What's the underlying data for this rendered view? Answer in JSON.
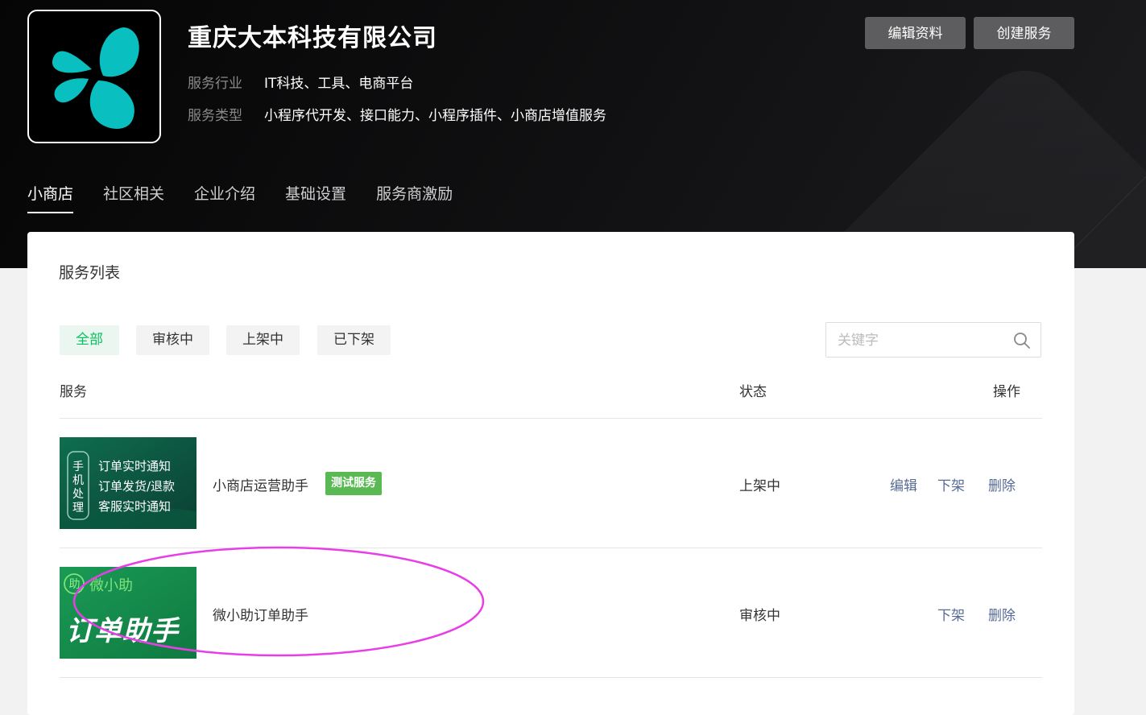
{
  "header": {
    "company_name": "重庆大本科技有限公司",
    "industry_label": "服务行业",
    "industry_value": "IT科技、工具、电商平台",
    "type_label": "服务类型",
    "type_value": "小程序代开发、接口能力、小程序插件、小商店增值服务",
    "edit_profile_label": "编辑资料",
    "create_service_label": "创建服务"
  },
  "tabs": [
    {
      "label": "小商店",
      "active": true
    },
    {
      "label": "社区相关"
    },
    {
      "label": "企业介绍"
    },
    {
      "label": "基础设置"
    },
    {
      "label": "服务商激励"
    }
  ],
  "panel": {
    "title": "服务列表",
    "filters": [
      {
        "label": "全部",
        "active": true
      },
      {
        "label": "审核中"
      },
      {
        "label": "上架中"
      },
      {
        "label": "已下架"
      }
    ],
    "search_placeholder": "关键字",
    "columns": {
      "service": "服务",
      "status": "状态",
      "actions": "操作"
    }
  },
  "rows": [
    {
      "thumb_side": "手机处理",
      "thumb_side_chars": [
        "手",
        "机",
        "处",
        "理"
      ],
      "thumb_lines": [
        "订单实时通知",
        "订单发货/退款",
        "客服实时通知"
      ],
      "name": "小商店运营助手",
      "badge": "测试服务",
      "status": "上架中",
      "actions": [
        "编辑",
        "下架",
        "删除"
      ]
    },
    {
      "thumb_brand_icon": "助",
      "thumb_brand": "微小助",
      "thumb_title": "订单助手",
      "name": "微小助订单助手",
      "status": "审核中",
      "actions": [
        "下架",
        "删除"
      ]
    }
  ],
  "colors": {
    "accent_green": "#07c160",
    "badge_green": "#5ab952",
    "link_blue": "#576b95",
    "logo_teal": "#0abfbf",
    "annotation_magenta": "#e83ee8"
  },
  "icons": {
    "search": "search-icon",
    "logo": "petal-logo"
  }
}
